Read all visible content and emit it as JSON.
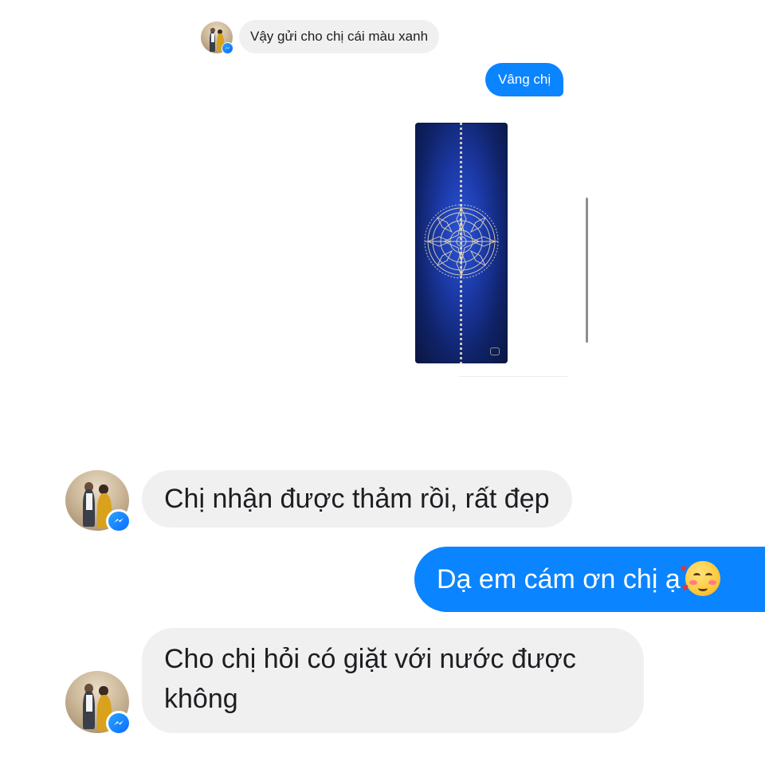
{
  "conversation": {
    "messages": [
      {
        "sender": "contact",
        "text": "Vậy gửi cho chị cái màu xanh"
      },
      {
        "sender": "me",
        "text": "Vâng chị"
      },
      {
        "sender": "me",
        "attachment": "blue-mandala-yoga-mat-photo"
      },
      {
        "sender": "contact",
        "text": "Chị nhận được thảm rồi, rất đẹp"
      },
      {
        "sender": "me",
        "text": "Dạ em cám ơn chị ạ",
        "emoji": "smiling-face-with-hearts"
      },
      {
        "sender": "contact",
        "text": "Cho chị hỏi có giặt với nước được không"
      }
    ]
  },
  "colors": {
    "incoming_bubble": "#f1f0f0",
    "outgoing_bubble": "#0b84ff",
    "messenger_badge": "#0a6cff",
    "mat_blue": "#1c3aa8"
  },
  "icons": {
    "badge": "messenger-icon",
    "emoji": "smiling-face-with-hearts-icon"
  }
}
